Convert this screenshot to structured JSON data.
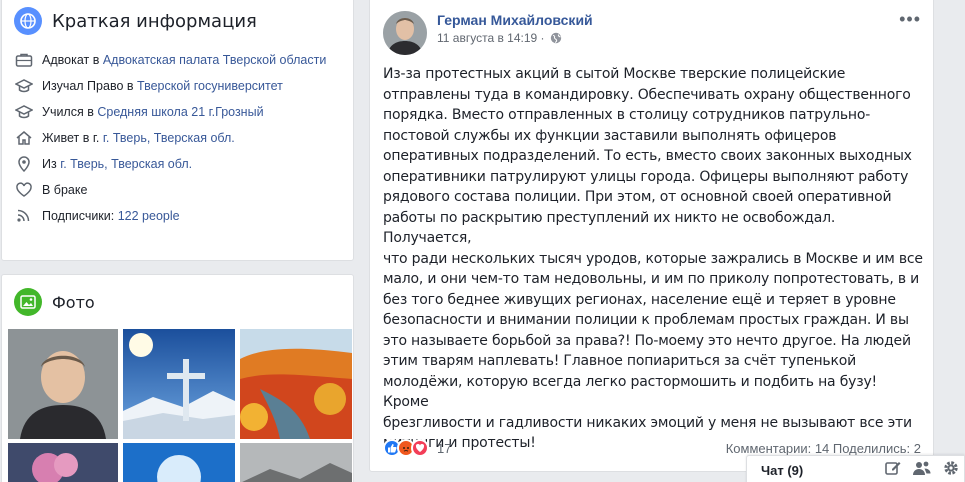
{
  "intro": {
    "title": "Краткая информация",
    "rows": [
      {
        "pre": "Адвокат в ",
        "link": "Адвокатская палата Тверской области",
        "icon": "briefcase-icon"
      },
      {
        "pre": "Изучал Право в ",
        "link": "Тверской госуниверситет",
        "icon": "graduation-cap-icon"
      },
      {
        "pre": "Учился в ",
        "link": "Средняя школа 21 г.Грозный",
        "icon": "graduation-cap-icon"
      },
      {
        "pre": "Живет в г. ",
        "link": "г. Тверь, Тверская обл.",
        "icon": "home-icon"
      },
      {
        "pre": "Из ",
        "link": "г. Тверь, Тверская обл.",
        "icon": "location-pin-icon"
      },
      {
        "pre": "В браке",
        "link": "",
        "icon": "heart-icon"
      },
      {
        "pre": "Подписчики: ",
        "link": "122 people",
        "icon": "rss-icon"
      }
    ]
  },
  "photos": {
    "title": "Фото"
  },
  "post": {
    "author": "Герман Михайловский",
    "date": "11 августа в 14:19 ·",
    "text": "Из-за протестных акций в сытой Москве тверские полицейские\nотправлены туда в командировку. Обеспечивать охрану общественного\nпорядка. Вместо отправленных в столицу сотрудников патрульно-\nпостовой службы их функции заставили выполнять офицеров\nоперативных подразделений. То есть, вместо своих законных выходных\nоперативники патрулируют улицы города. Офицеры выполняют работу\nрядового состава полиции. При этом, от основной своей оперативной\nработы по раскрытию преступлений их никто не освобождал. Получается,\nчто ради нескольких тысяч уродов, которые зажрались в Москве и им все\nмало, и они чем-то там недовольны, и им по приколу попротестовать, в и\nбез того беднее живущих регионах, население ещё и теряет в уровне\nбезопасности и внимании полиции к проблемам простых граждан. И вы\nэто называете борьбой за права?! По-моему это нечто другое. На людей\nэтим тварям наплевать! Главное попиариться за счёт тупенькой\nмолодёжи, которую всегда легко растормошить и подбить на бузу! Кроме\nбрезгливости и гадливости никаких эмоций у меня не вызывают все эти\nмитинги и протесты!",
    "reaction_count": "17",
    "stats": "Комментарии: 14  Поделились: 2"
  },
  "chat": {
    "label": "Чат (9)"
  },
  "colors": {
    "link": "#385898",
    "author": "#365899",
    "like": "#2078f4",
    "angry": "#f0581e",
    "love": "#f33e58"
  }
}
